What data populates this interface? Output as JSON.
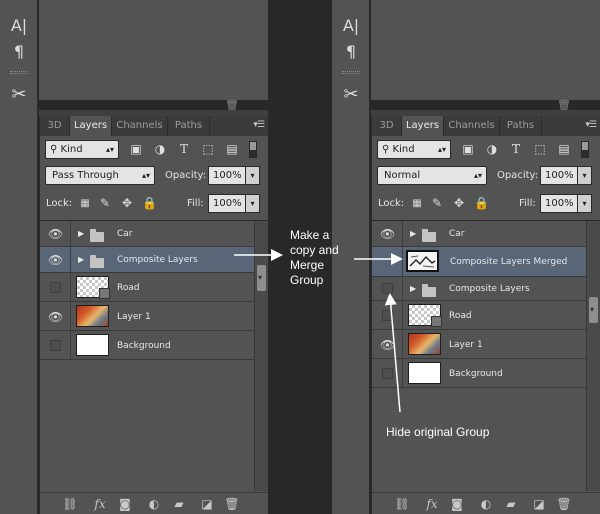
{
  "panels": {
    "left": {
      "tabs": [
        "3D",
        "Layers",
        "Channels",
        "Paths"
      ],
      "active_tab": "Layers",
      "filter": "Kind",
      "blend_mode": "Pass Through",
      "opacity_label": "Opacity:",
      "opacity": "100%",
      "lock_label": "Lock:",
      "fill_label": "Fill:",
      "fill": "100%",
      "layers": [
        {
          "name": "Car",
          "type": "group",
          "visible": true,
          "selected": false
        },
        {
          "name": "Composite Layers",
          "type": "group",
          "visible": true,
          "selected": true
        },
        {
          "name": "Road",
          "type": "smart",
          "visible": false,
          "selected": false
        },
        {
          "name": "Layer 1",
          "type": "photo",
          "visible": true,
          "selected": false
        },
        {
          "name": "Background",
          "type": "white",
          "visible": false,
          "selected": false
        }
      ]
    },
    "right": {
      "tabs": [
        "3D",
        "Layers",
        "Channels",
        "Paths"
      ],
      "active_tab": "Layers",
      "filter": "Kind",
      "blend_mode": "Normal",
      "opacity_label": "Opacity:",
      "opacity": "100%",
      "lock_label": "Lock:",
      "fill_label": "Fill:",
      "fill": "100%",
      "layers": [
        {
          "name": "Car",
          "type": "group",
          "visible": true,
          "selected": false
        },
        {
          "name": "Composite Layers Merged",
          "type": "merged",
          "visible": true,
          "selected": true
        },
        {
          "name": "Composite Layers",
          "type": "group",
          "visible": false,
          "selected": false
        },
        {
          "name": "Road",
          "type": "smart",
          "visible": false,
          "selected": false
        },
        {
          "name": "Layer 1",
          "type": "photo",
          "visible": true,
          "selected": false
        },
        {
          "name": "Background",
          "type": "white",
          "visible": false,
          "selected": false
        }
      ]
    }
  },
  "annotations": {
    "copy_merge": [
      "Make a",
      "copy and",
      "Merge",
      "Group"
    ],
    "hide_original": "Hide original Group"
  },
  "icons": {
    "toolstrip": [
      "character-icon",
      "paragraph-icon",
      "tools-icon"
    ],
    "filter": [
      "image-filter-icon",
      "adjustment-filter-icon",
      "type-filter-icon",
      "shape-filter-icon",
      "smart-object-filter-icon"
    ],
    "lock": [
      "lock-transparent-icon",
      "lock-image-icon",
      "lock-position-icon",
      "lock-all-icon"
    ],
    "bottom": [
      "link-icon",
      "fx-icon",
      "mask-icon",
      "adjustment-icon",
      "folder-icon",
      "new-layer-icon",
      "trash-icon"
    ]
  },
  "colors": {
    "panel_bg": "#535353",
    "selected_row": "#596678",
    "tab_bar": "#3b3b3b",
    "divider": "#282828",
    "annotation": "#ffffff"
  }
}
